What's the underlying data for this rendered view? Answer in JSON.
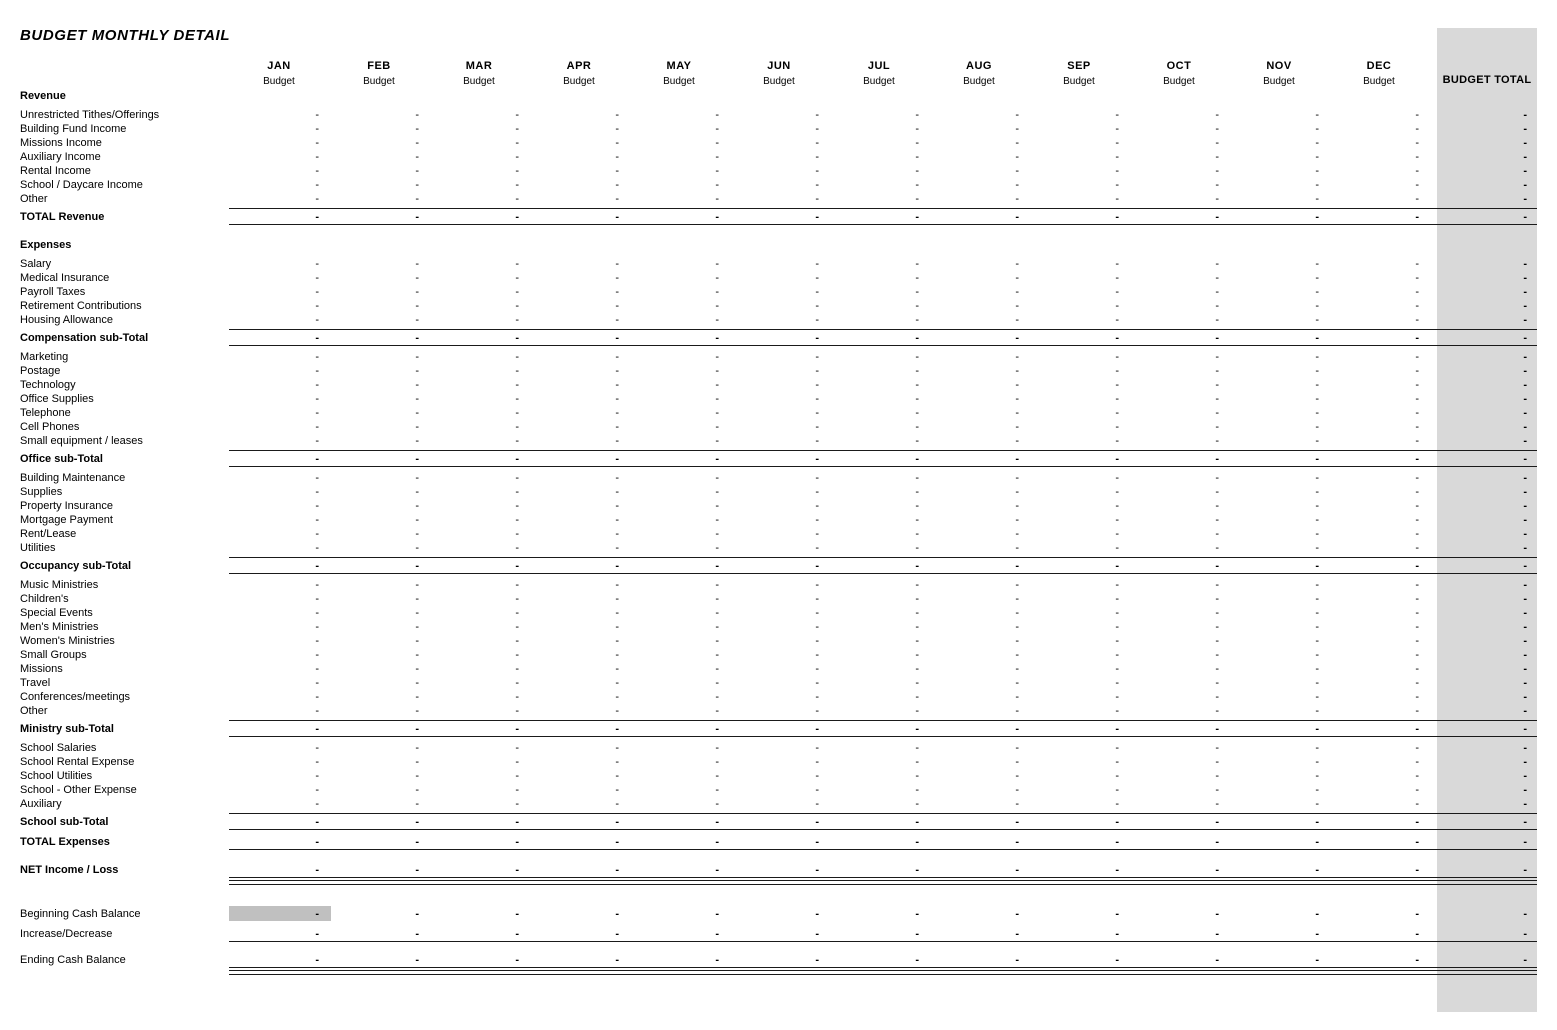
{
  "document": {
    "title": "BUDGET MONTHLY DETAIL"
  },
  "colors": {
    "total_band": "#d9d9d9",
    "highlight_cell": "#c0c0c0",
    "rule": "#1a1a1a",
    "text": "#000000"
  },
  "header": {
    "months": [
      {
        "month": "JAN",
        "sub": "Budget"
      },
      {
        "month": "FEB",
        "sub": "Budget"
      },
      {
        "month": "MAR",
        "sub": "Budget"
      },
      {
        "month": "APR",
        "sub": "Budget"
      },
      {
        "month": "MAY",
        "sub": "Budget"
      },
      {
        "month": "JUN",
        "sub": "Budget"
      },
      {
        "month": "JUL",
        "sub": "Budget"
      },
      {
        "month": "AUG",
        "sub": "Budget"
      },
      {
        "month": "SEP",
        "sub": "Budget"
      },
      {
        "month": "OCT",
        "sub": "Budget"
      },
      {
        "month": "NOV",
        "sub": "Budget"
      },
      {
        "month": "DEC",
        "sub": "Budget"
      }
    ],
    "total_column_label": "BUDGET TOTAL"
  },
  "empty_value": "-",
  "sections": [
    {
      "heading": "Revenue",
      "items": [
        "Unrestricted Tithes/Offerings",
        "Building Fund Income",
        "Missions Income",
        "Auxiliary Income",
        "Rental Income",
        "School / Daycare Income",
        "Other"
      ],
      "total_label": "TOTAL Revenue"
    },
    {
      "heading": "Expenses",
      "items": [
        "Salary",
        "Medical Insurance",
        "Payroll Taxes",
        "Retirement Contributions",
        "Housing Allowance"
      ],
      "total_label": "Compensation sub-Total"
    },
    {
      "heading": "",
      "items": [
        "Marketing",
        "Postage",
        "Technology",
        "Office Supplies",
        "Telephone",
        "Cell Phones",
        "Small equipment / leases"
      ],
      "total_label": "Office sub-Total"
    },
    {
      "heading": "",
      "items": [
        "Building Maintenance",
        "Supplies",
        "Property Insurance",
        "Mortgage Payment",
        "Rent/Lease",
        "Utilities"
      ],
      "total_label": "Occupancy sub-Total"
    },
    {
      "heading": "",
      "items": [
        "Music Ministries",
        "Children's",
        "Special Events",
        "Men's Ministries",
        "Women's Ministries",
        "Small Groups",
        "Missions",
        "Travel",
        "Conferences/meetings",
        "Other"
      ],
      "total_label": "Ministry sub-Total"
    },
    {
      "heading": "",
      "items": [
        "School Salaries",
        "School Rental Expense",
        "School Utilities",
        "School - Other Expense",
        "Auxiliary"
      ],
      "total_label": "School sub-Total"
    }
  ],
  "summary": {
    "total_expenses_label": "TOTAL Expenses",
    "net_income_label": "NET Income / Loss",
    "beginning_cash_label": "Beginning Cash Balance",
    "increase_decrease_label": "Increase/Decrease",
    "ending_cash_label": "Ending Cash Balance"
  }
}
